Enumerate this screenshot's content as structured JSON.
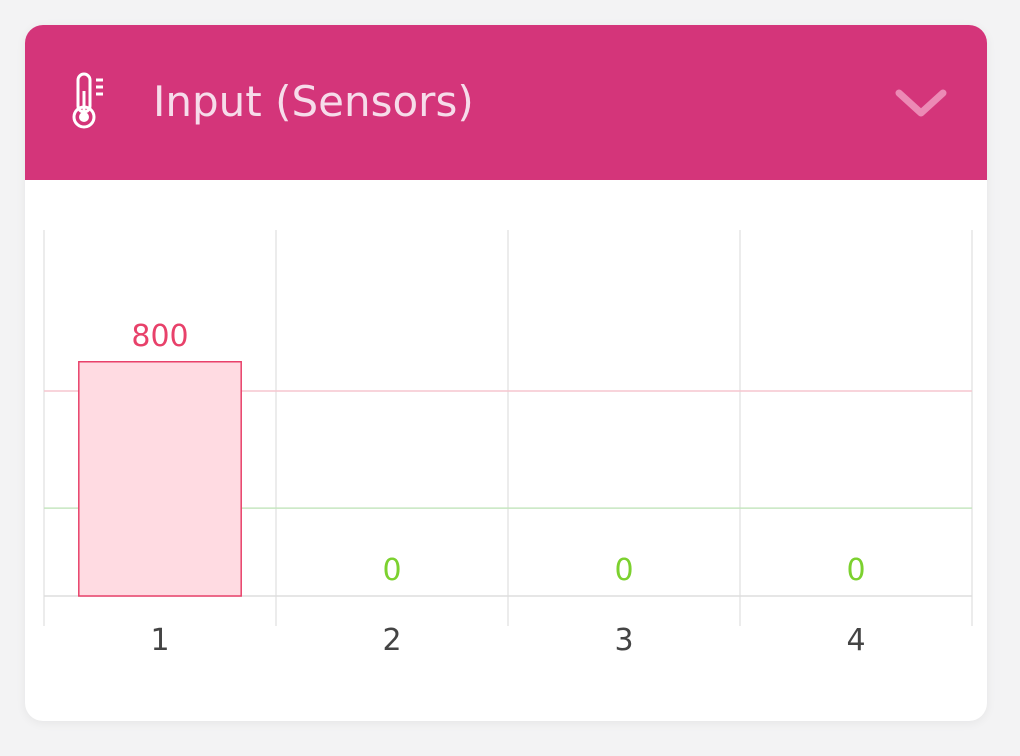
{
  "widget": {
    "title": "Input (Sensors)",
    "icon": "thermometer-icon",
    "toggle_icon": "chevron-down-icon",
    "header_color": "#d4357a"
  },
  "chart_data": {
    "type": "bar",
    "categories": [
      "1",
      "2",
      "3",
      "4"
    ],
    "values": [
      800,
      0,
      0,
      0
    ],
    "data_labels": [
      "800",
      "0",
      "0",
      "0"
    ],
    "ylim": [
      0,
      1250
    ],
    "reference_lines": [
      {
        "value": 700,
        "color": "#f5c6cf"
      },
      {
        "value": 300,
        "color": "#c6e6c0"
      }
    ],
    "grid": true,
    "colors": {
      "bar_fill": "#ffdbe2",
      "bar_stroke": "#e8416a",
      "label_nonzero": "#e8416a",
      "label_zero": "#7cd12f",
      "tick_label": "#444444",
      "grid": "#e6e6e6"
    }
  }
}
